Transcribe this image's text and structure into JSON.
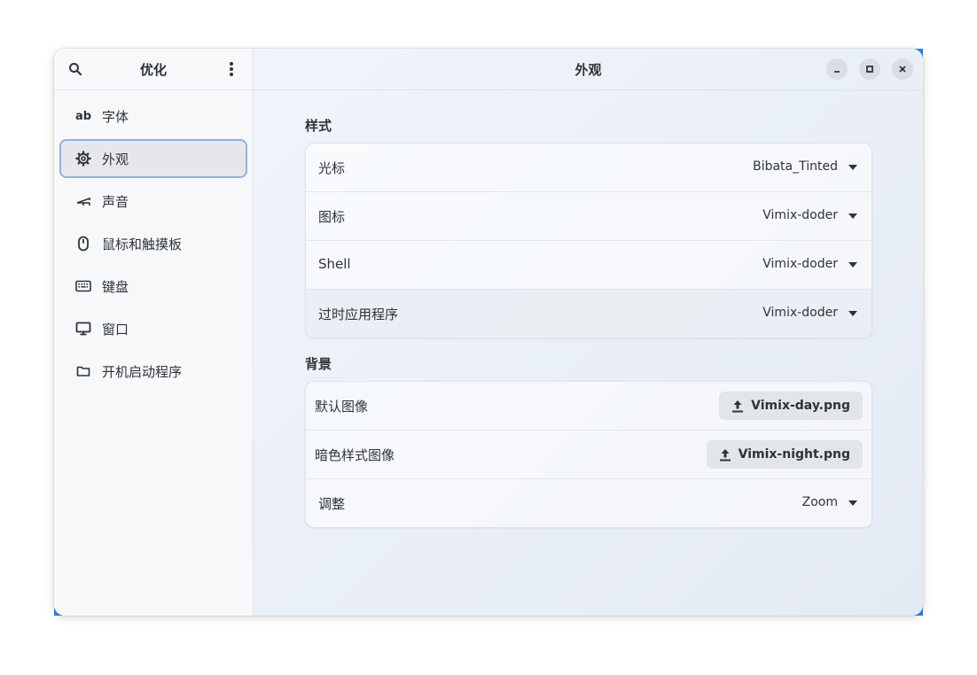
{
  "sidebar": {
    "title": "优化",
    "items": [
      {
        "label": "字体",
        "icon": "font-icon"
      },
      {
        "label": "外观",
        "icon": "gear-icon"
      },
      {
        "label": "声音",
        "icon": "sound-icon"
      },
      {
        "label": "鼠标和触摸板",
        "icon": "mouse-icon"
      },
      {
        "label": "键盘",
        "icon": "keyboard-icon"
      },
      {
        "label": "窗口",
        "icon": "monitor-icon"
      },
      {
        "label": "开机启动程序",
        "icon": "folder-icon"
      }
    ],
    "font_icon_text": "ab"
  },
  "main": {
    "title": "外观",
    "styles": {
      "heading": "样式",
      "rows": [
        {
          "label": "光标",
          "value": "Bibata_Tinted"
        },
        {
          "label": "图标",
          "value": "Vimix-doder"
        },
        {
          "label": "Shell",
          "value": "Vimix-doder"
        },
        {
          "label": "过时应用程序",
          "value": "Vimix-doder"
        }
      ]
    },
    "background": {
      "heading": "背景",
      "rows": [
        {
          "label": "默认图像",
          "value": "Vimix-day.png"
        },
        {
          "label": "暗色样式图像",
          "value": "Vimix-night.png"
        },
        {
          "label": "调整",
          "value": "Zoom"
        }
      ]
    }
  },
  "colors": {
    "accent": "#3584e4",
    "selected_border": "#8fb3dd"
  }
}
